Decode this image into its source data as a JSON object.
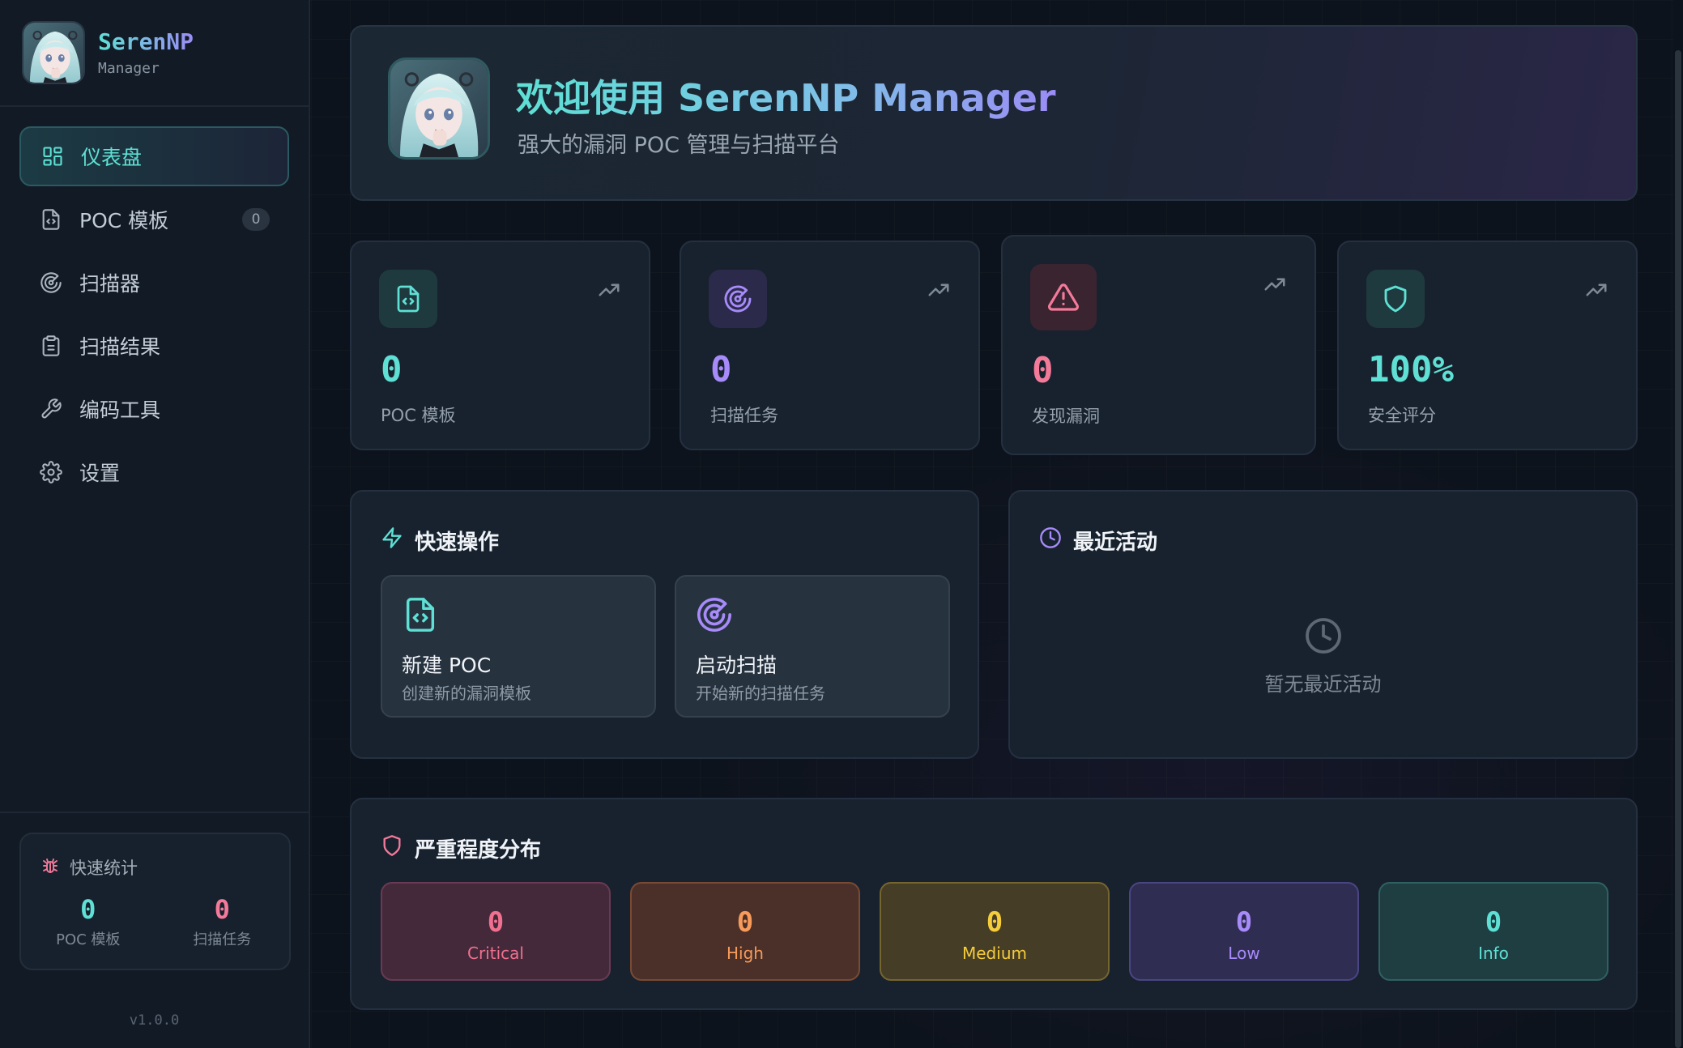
{
  "brand": {
    "name": "SerenNP",
    "subtitle": "Manager"
  },
  "nav": {
    "items": [
      {
        "label": "仪表盘",
        "icon": "dashboard-icon",
        "active": true
      },
      {
        "label": "POC 模板",
        "icon": "file-code-icon",
        "badge": "0"
      },
      {
        "label": "扫描器",
        "icon": "radar-icon"
      },
      {
        "label": "扫描结果",
        "icon": "clipboard-icon"
      },
      {
        "label": "编码工具",
        "icon": "wrench-icon"
      },
      {
        "label": "设置",
        "icon": "gear-icon"
      }
    ]
  },
  "quick_stats": {
    "title": "快速统计",
    "poc_value": "0",
    "poc_label": "POC 模板",
    "scan_value": "0",
    "scan_label": "扫描任务"
  },
  "version": "v1.0.0",
  "welcome": {
    "title": "欢迎使用 SerenNP Manager",
    "subtitle": "强大的漏洞 POC 管理与扫描平台"
  },
  "stats": [
    {
      "value": "0",
      "label": "POC 模板",
      "color": "#5ee0d4"
    },
    {
      "value": "0",
      "label": "扫描任务",
      "color": "#a78bfa"
    },
    {
      "value": "0",
      "label": "发现漏洞",
      "color": "#f47a9a"
    },
    {
      "value": "100%",
      "label": "安全评分",
      "color": "#5ee0d4"
    }
  ],
  "quick_actions": {
    "title": "快速操作",
    "new_poc": {
      "title": "新建 POC",
      "desc": "创建新的漏洞模板"
    },
    "start_scan": {
      "title": "启动扫描",
      "desc": "开始新的扫描任务"
    }
  },
  "recent": {
    "title": "最近活动",
    "empty": "暂无最近活动"
  },
  "severity": {
    "title": "严重程度分布",
    "levels": [
      {
        "label": "Critical",
        "value": "0",
        "color": "#f0708f"
      },
      {
        "label": "High",
        "value": "0",
        "color": "#f79a5a"
      },
      {
        "label": "Medium",
        "value": "0",
        "color": "#f5cc3a"
      },
      {
        "label": "Low",
        "value": "0",
        "color": "#a78bfa"
      },
      {
        "label": "Info",
        "value": "0",
        "color": "#5ee0d4"
      }
    ]
  }
}
